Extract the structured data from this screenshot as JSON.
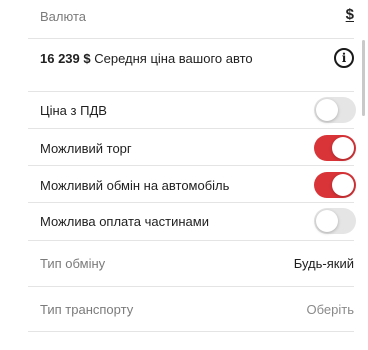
{
  "currency": {
    "label": "Валюта",
    "value": "$"
  },
  "price": {
    "amount": "16 239 $",
    "text": "Середня ціна вашого авто",
    "info_icon": "info-icon"
  },
  "toggles": [
    {
      "label": "Ціна з ПДВ",
      "on": false
    },
    {
      "label": "Можливий торг",
      "on": true
    },
    {
      "label": "Можливий обмін на автомобіль",
      "on": true
    },
    {
      "label": "Можлива оплата частинами",
      "on": false
    }
  ],
  "exchange_type": {
    "label": "Тип обміну",
    "value": "Будь-який"
  },
  "transport_type": {
    "label": "Тип транспорту",
    "value": "Оберіть"
  },
  "colors": {
    "accent": "#d93438",
    "toggle_off": "#e5e5e5",
    "divider": "#e4e4e4"
  }
}
